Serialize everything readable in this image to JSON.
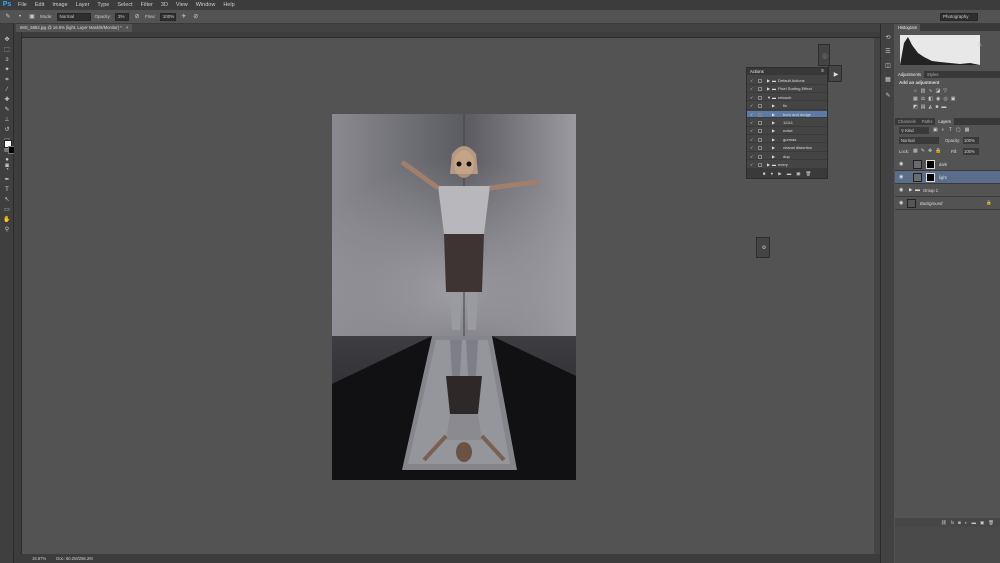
{
  "menubar": {
    "logo": "Ps",
    "items": [
      "File",
      "Edit",
      "Image",
      "Layer",
      "Type",
      "Select",
      "Filter",
      "3D",
      "View",
      "Window",
      "Help"
    ]
  },
  "options": {
    "mode_label": "Mode:",
    "mode_value": "Normal",
    "opacity_label": "Opacity:",
    "opacity_value": "3%",
    "flow_label": "Flow:",
    "flow_value": "100%",
    "workspace": "Photography"
  },
  "document": {
    "tab_title": "IMG_5663.jpg @ 16.6% (light, Layer Mask/8/Monitor) *"
  },
  "status": {
    "zoom": "16.67%",
    "doc_size": "Doc: 60.2M/256.2M"
  },
  "actions_panel": {
    "title": "Actions",
    "rows": [
      {
        "name": "Default Actions",
        "level": 0,
        "folder": true,
        "expanded": false,
        "selected": false
      },
      {
        "name": "Pixel Sorting Effect",
        "level": 0,
        "folder": true,
        "expanded": false,
        "selected": false
      },
      {
        "name": "retouch",
        "level": 0,
        "folder": true,
        "expanded": true,
        "selected": false
      },
      {
        "name": "fix",
        "level": 1,
        "folder": false,
        "expanded": false,
        "selected": false
      },
      {
        "name": "burn and dodge",
        "level": 1,
        "folder": false,
        "expanded": false,
        "selected": true
      },
      {
        "name": "11111",
        "level": 1,
        "folder": false,
        "expanded": false,
        "selected": false
      },
      {
        "name": "noise",
        "level": 1,
        "folder": false,
        "expanded": false,
        "selected": false
      },
      {
        "name": "gurmas",
        "level": 1,
        "folder": false,
        "expanded": false,
        "selected": false
      },
      {
        "name": "chanal distortion",
        "level": 1,
        "folder": false,
        "expanded": false,
        "selected": false
      },
      {
        "name": "dup",
        "level": 1,
        "folder": false,
        "expanded": false,
        "selected": false
      },
      {
        "name": "every",
        "level": 0,
        "folder": true,
        "expanded": false,
        "selected": false
      }
    ]
  },
  "histogram_panel": {
    "title": "Histogram"
  },
  "adjustments_panel": {
    "tabs": [
      "Adjustments",
      "Styles"
    ],
    "heading": "Add an adjustment"
  },
  "layers_panel": {
    "tabs": [
      "Channels",
      "Paths",
      "Layers"
    ],
    "filter": "Kind",
    "blend_mode": "Normal",
    "opacity_label": "Opacity:",
    "opacity_value": "100%",
    "lock_label": "Lock:",
    "fill_label": "Fill:",
    "fill_value": "100%",
    "layers": [
      {
        "name": "dark",
        "selected": false,
        "type": "mask"
      },
      {
        "name": "light",
        "selected": true,
        "type": "mask"
      },
      {
        "name": "Group 1",
        "selected": false,
        "type": "group"
      },
      {
        "name": "Background",
        "selected": false,
        "type": "background"
      }
    ]
  },
  "icons": {
    "mini_panel_1": "info-icon",
    "mini_panel_2": "play-icon"
  }
}
